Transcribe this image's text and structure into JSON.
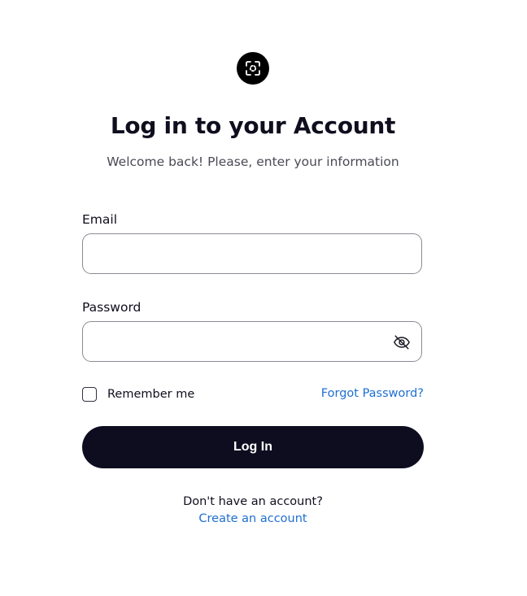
{
  "logo": {
    "icon": "focus-frame-icon",
    "bg_color": "#000000"
  },
  "header": {
    "title": "Log in to your Account",
    "subtitle": "Welcome back! Please, enter your information"
  },
  "form": {
    "email_label": "Email",
    "email_value": "",
    "password_label": "Password",
    "password_value": "",
    "password_toggle_icon": "eye-off-icon",
    "remember_label": "Remember me",
    "remember_checked": false,
    "forgot_label": "Forgot Password?",
    "submit_label": "Log In"
  },
  "footer": {
    "prompt": "Don't have an account?",
    "create_label": "Create an account"
  },
  "colors": {
    "primary_button": "#0e0d20",
    "link": "#1f6fd1",
    "field_border": "#8b8b93"
  }
}
